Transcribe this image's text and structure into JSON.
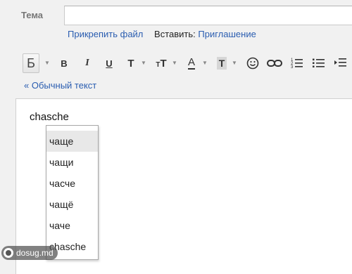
{
  "compose": {
    "subject_label": "Тема",
    "subject_value": "",
    "attach_link": "Прикрепить файл",
    "insert_label": "Вставить:",
    "invitation_link": "Приглашение"
  },
  "toolbar": {
    "bold_button_label": "Б",
    "items": [
      "bold-button",
      "italic-button",
      "underline-button",
      "font-button",
      "font-size-button",
      "text-color-button",
      "highlight-button",
      "emoji-icon",
      "link-icon",
      "numbered-list-icon",
      "bulleted-list-icon",
      "indent-icon"
    ]
  },
  "plain_text_link": "« Обычный текст",
  "editor": {
    "typed_word": "chasche"
  },
  "suggestions": {
    "items": [
      "чаще",
      "чащи",
      "часче",
      "чащё",
      "чаче",
      "chasche"
    ],
    "selected_index": 0
  },
  "watermark": {
    "text": "dosug.md"
  },
  "colors": {
    "link": "#2a5db0",
    "selected_suggestion_bg": "#e8e8e8"
  }
}
